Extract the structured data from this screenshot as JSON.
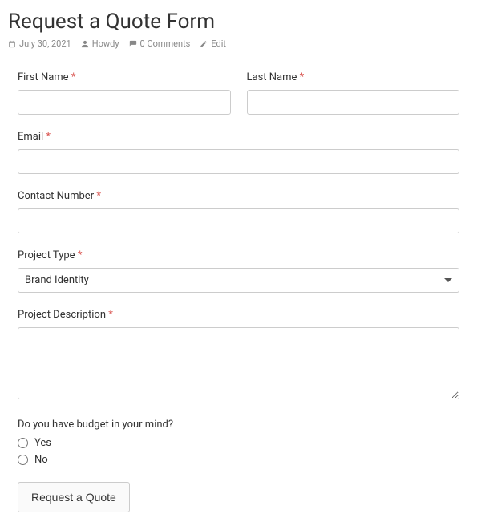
{
  "header": {
    "title": "Request a Quote Form",
    "meta": {
      "date": "July 30, 2021",
      "author": "Howdy",
      "comments": "0 Comments",
      "edit": "Edit"
    }
  },
  "form": {
    "first_name_label": "First Name",
    "last_name_label": "Last Name",
    "email_label": "Email",
    "contact_label": "Contact Number",
    "project_type_label": "Project Type",
    "project_type_selected": "Brand Identity",
    "project_desc_label": "Project Description",
    "budget_question": "Do you have budget in your mind?",
    "budget_yes": "Yes",
    "budget_no": "No",
    "submit_label": "Request a Quote",
    "required_mark": "*"
  }
}
